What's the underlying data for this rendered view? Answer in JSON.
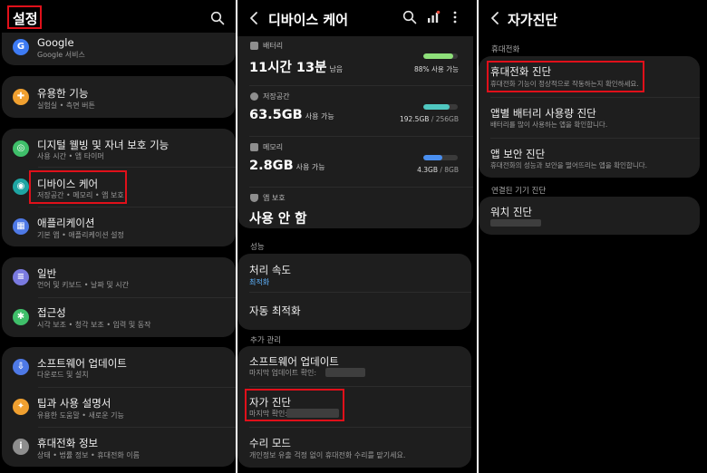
{
  "settings": {
    "title": "설정",
    "items": [
      {
        "name": "Google",
        "sub": "Google 서비스",
        "color": "#3e7bf4",
        "glyph": "G"
      },
      {
        "name": "유용한 기능",
        "sub": "실험실 • 측면 버튼",
        "color": "#f0a030",
        "glyph": "✚"
      },
      {
        "name": "디지털 웰빙 및 자녀 보호 기능",
        "sub": "사용 시간 • 앱 타이머",
        "color": "#3fbf6a",
        "glyph": "◎"
      },
      {
        "name": "디바이스 케어",
        "sub": "저장공간 • 메모리 • 앱 보호",
        "color": "#1ea5a3",
        "glyph": "◉"
      },
      {
        "name": "애플리케이션",
        "sub": "기본 앱 • 애플리케이션 설정",
        "color": "#4e79e6",
        "glyph": "▦"
      },
      {
        "name": "일반",
        "sub": "언어 및 키보드 • 날짜 및 시간",
        "color": "#7a7ae0",
        "glyph": "≡"
      },
      {
        "name": "접근성",
        "sub": "시각 보조 • 청각 보조 • 입력 및 동작",
        "color": "#3fbf6a",
        "glyph": "✱"
      },
      {
        "name": "소프트웨어 업데이트",
        "sub": "다운로드 및 설치",
        "color": "#4e79e6",
        "glyph": "⇩"
      },
      {
        "name": "팁과 사용 설명서",
        "sub": "유용한 도움말 • 새로운 기능",
        "color": "#f0a030",
        "glyph": "✦"
      },
      {
        "name": "휴대전화 정보",
        "sub": "상태 • 법률 정보 • 휴대전화 이름",
        "color": "#8e8e8e",
        "glyph": "i"
      }
    ]
  },
  "devicecare": {
    "title": "디바이스 케어",
    "battery": {
      "label": "배터리",
      "value": "11시간 13분",
      "unit": "남음",
      "pct_text": "88%",
      "pct_suffix": "사용 가능",
      "level": 0.88,
      "color": "#8ee07a"
    },
    "storage": {
      "label": "저장공간",
      "value": "63.5GB",
      "unit": "사용 가능",
      "used": "192.5GB",
      "total": "/ 256GB",
      "level": 0.75,
      "color": "#4fc7c0"
    },
    "memory": {
      "label": "메모리",
      "value": "2.8GB",
      "unit": "사용 가능",
      "used": "4.3GB",
      "total": "/ 8GB",
      "level": 0.54,
      "color": "#4a8ff0"
    },
    "protect": {
      "label": "앱 보호",
      "value": "사용 안 함"
    },
    "perf_label": "성능",
    "speed": {
      "title": "처리 속도",
      "sub": "최적화",
      "sub_color": "#5fb4ff"
    },
    "auto_opt": "자동 최적화",
    "extra_label": "추가 관리",
    "sw_update": {
      "title": "소프트웨어 업데이트",
      "sub": "마지막 업데이트 확인:"
    },
    "selfdiag": {
      "title": "자가 진단",
      "sub": "마지막 확인:"
    },
    "repair": {
      "title": "수리 모드",
      "sub": "개인정보 유출 걱정 없이 휴대전화 수리를 맡기세요."
    }
  },
  "selfdiag": {
    "title": "자가진단",
    "phone_label": "휴대전화",
    "items": [
      {
        "title": "휴대전화 진단",
        "sub": "휴대전화 기능이 정상적으로 작동하는지 확인하세요."
      },
      {
        "title": "앱별 배터리 사용량 진단",
        "sub": "배터리를 많이 사용하는 앱을 확인합니다."
      },
      {
        "title": "앱 보안 진단",
        "sub": "휴대전화의 성능과 보안을 떨어뜨리는 앱을 확인합니다."
      }
    ],
    "connected_label": "연결된 기기 진단",
    "watch": "워치 진단"
  }
}
